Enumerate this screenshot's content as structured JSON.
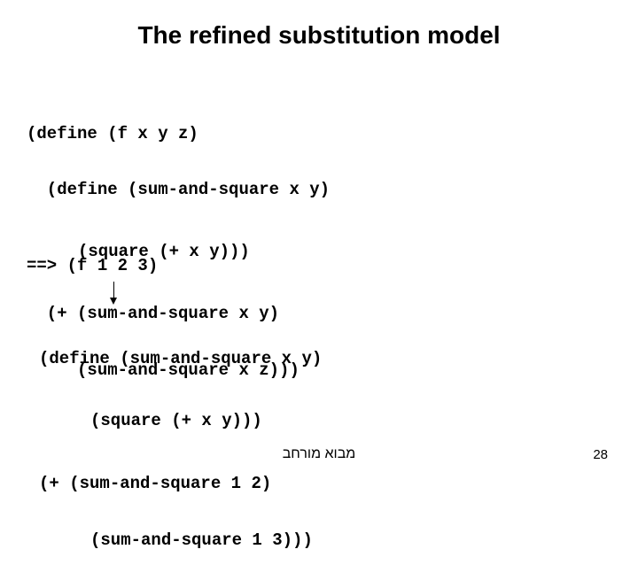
{
  "title": "The refined substitution model",
  "code1": {
    "l1": "(define (f x y z)",
    "l2": "  (define (sum-and-square x y)",
    "l3": "(square (+ x y)))",
    "l4": "  (+ (sum-and-square x y)",
    "l5": "     (sum-and-square x z)))"
  },
  "eval_line": "==> (f 1 2 3)",
  "code2": {
    "l1": "(define (sum-and-square x y)",
    "l2": "(square (+ x y)))",
    "l3": "(+ (sum-and-square 1 2)",
    "l4": "(sum-and-square 1 3)))"
  },
  "footer": "מבוא מורחב",
  "page": "28"
}
